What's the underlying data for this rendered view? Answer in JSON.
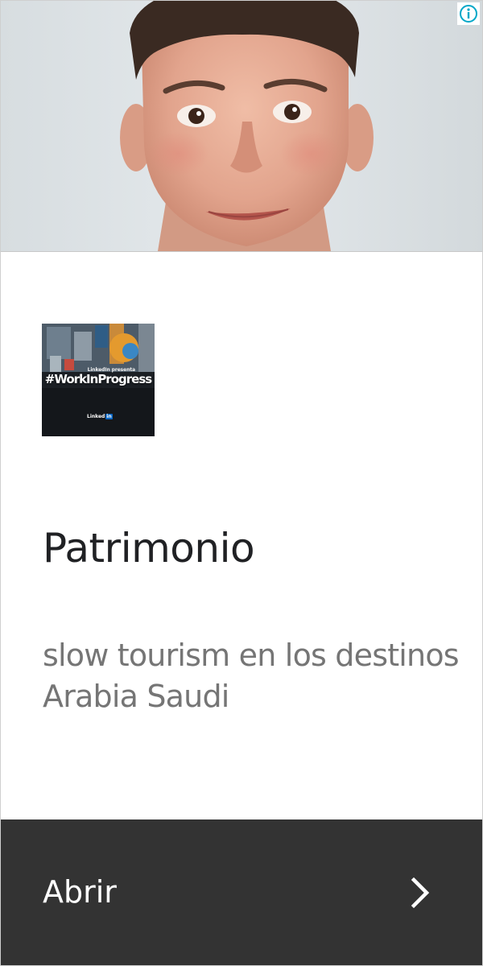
{
  "ad": {
    "hero_image": {
      "icon": "person-portrait-photo"
    },
    "info_badge": {
      "icon": "info-icon",
      "color": "#00a7c8"
    },
    "thumbnail": {
      "subtitle": "LinkedIn presenta",
      "hashtag": "#WorkInProgress",
      "brand_name": "Linked",
      "brand_badge": "in",
      "brand_color": "#0a66c2"
    },
    "headline": "Patrimonio",
    "description": "slow tourism en los destinos Arabia Saudi",
    "cta": {
      "label": "Abrir",
      "icon": "chevron-right-icon",
      "background": "#333333"
    }
  }
}
